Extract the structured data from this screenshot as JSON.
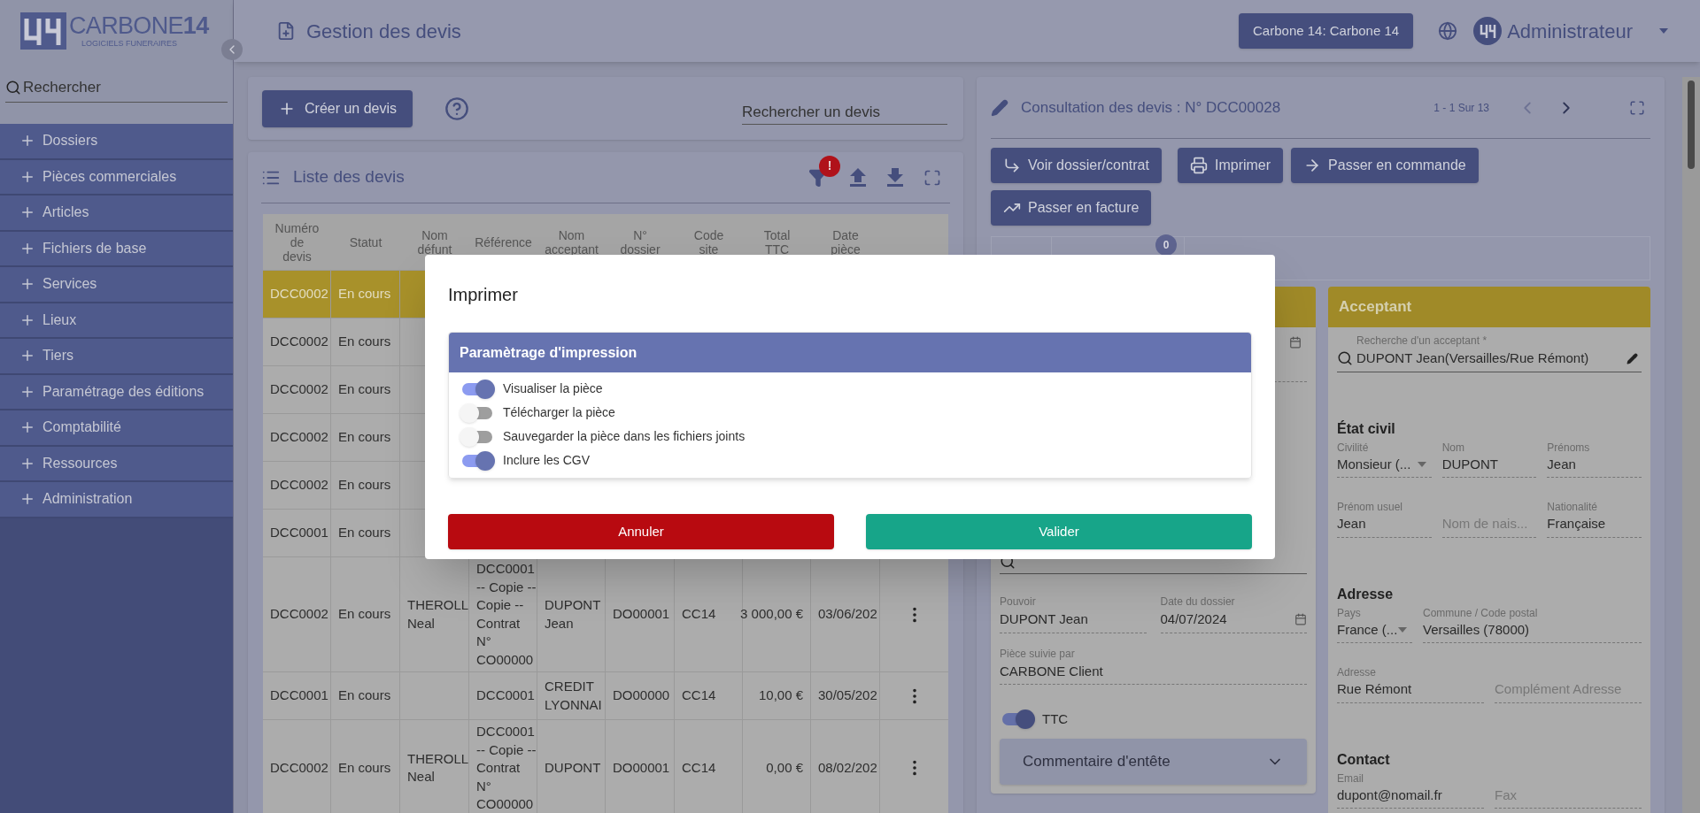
{
  "sidebar": {
    "logo": "CARBONE**14**",
    "tagline": "LOGICIELS FUNERAIRES",
    "search": {
      "placeholder": "Rechercher"
    },
    "items": [
      {
        "label": "Dossiers",
        "expanded": false
      },
      {
        "label": "Pièces commerciales",
        "expanded": false
      },
      {
        "label": "Articles",
        "expanded": false
      },
      {
        "label": "Fichiers de base",
        "expanded": false
      },
      {
        "label": "Services",
        "expanded": false
      },
      {
        "label": "Lieux",
        "expanded": false
      },
      {
        "label": "Tiers",
        "expanded": false
      },
      {
        "label": "Paramétrage des éditions",
        "expanded": false
      },
      {
        "label": "Comptabilité",
        "expanded": false
      },
      {
        "label": "Ressources",
        "expanded": false
      },
      {
        "label": "Administration",
        "expanded": false
      }
    ]
  },
  "header": {
    "title": "Gestion des devis",
    "company_button": "Carbone 14: Carbone 14",
    "user": "Administrateur"
  },
  "quotes_toolbar": {
    "create_button": "Créer un devis",
    "search": {
      "placeholder": "Rechercher un devis"
    }
  },
  "quotes_list": {
    "title": "Liste des devis",
    "filter_badge": "!",
    "columns": [
      "Numéro\nde\ndevis",
      "Statut",
      "Nom\ndéfunt",
      "Référence",
      "Nom\nacceptant",
      "N°\ndossier",
      "Code\nsite",
      "Total\nTTC",
      "Date\npièce"
    ],
    "rows": [
      {
        "selected": true,
        "cells": [
          "DCC0002",
          "En cours"
        ]
      },
      {
        "selected": false,
        "cells": [
          "DCC0002",
          "En cours"
        ]
      },
      {
        "selected": false,
        "cells": [
          "DCC0002",
          "En cours"
        ]
      },
      {
        "selected": false,
        "cells": [
          "DCC0002",
          "En cours"
        ]
      },
      {
        "selected": false,
        "cells": [
          "DCC0002",
          "En cours"
        ]
      },
      {
        "selected": false,
        "cells": [
          "DCC0001",
          "En cours"
        ]
      },
      {
        "selected": false,
        "cells": [
          "DCC0002",
          "En cours",
          "THEROLL\nNeal",
          "DCC0001\n-- Copie --\nCopie --\nContrat\nN°\nCO00000",
          "DUPONT\nJean",
          "DO00001",
          "CC14",
          "3 000,00 €",
          "03/06/202"
        ]
      },
      {
        "selected": false,
        "cells": [
          "DCC0001",
          "En cours",
          "",
          "DCC0001",
          "CREDIT\nLYONNAI",
          "DO00000",
          "CC14",
          "10,00 €",
          "30/05/202"
        ]
      },
      {
        "selected": false,
        "cells": [
          "DCC0002",
          "En cours",
          "THEROLL\nNeal",
          "DCC0001\n-- Copie --\nContrat\nN°\nCO00000",
          "DUPONT",
          "DO00001",
          "CC14",
          "0,00 €",
          "08/02/202"
        ]
      }
    ]
  },
  "consultation": {
    "title": "Consultation des devis : N° DCC00028",
    "pager": "1 - 1 Sur 13",
    "actions": [
      {
        "label": "Voir dossier/contrat",
        "kind": "open"
      },
      {
        "label": "Imprimer",
        "kind": "print"
      },
      {
        "label": "Passer en commande",
        "kind": "order"
      },
      {
        "label": "Passer en facture",
        "kind": "invoice"
      }
    ],
    "attachments_badge": "0",
    "quote_card": {
      "fields": [
        {
          "label": "Pouvoir",
          "value": "DUPONT Jean"
        },
        {
          "label": "Date du dossier",
          "value": "04/07/2024"
        },
        {
          "label": "Pièce suivie par",
          "value": "CARBONE Client"
        }
      ],
      "ttc": {
        "label": "TTC",
        "on": true
      },
      "comment_section": "Commentaire d'entête"
    },
    "acceptant_card": {
      "title": "Acceptant",
      "search": {
        "label": "Recherche d'un acceptant *",
        "value": "DUPONT Jean(Versailles/Rue Rémont)"
      },
      "sections": [
        {
          "title": "État civil",
          "rows": [
            [
              {
                "label": "Civilité",
                "value": "Monsieur (...",
                "kind": "select"
              },
              {
                "label": "Nom",
                "value": "DUPONT",
                "kind": "text"
              },
              {
                "label": "Prénoms",
                "value": "Jean",
                "kind": "text"
              }
            ],
            [
              {
                "label": "Prénom usuel",
                "value": "Jean",
                "kind": "text"
              },
              {
                "placeholder": "Nom de nais...",
                "kind": "text"
              },
              {
                "label": "Nationalité",
                "value": "Française",
                "kind": "text"
              }
            ]
          ]
        },
        {
          "title": "Adresse",
          "rows": [
            [
              {
                "label": "Pays",
                "value": "France (...",
                "kind": "select"
              },
              {
                "label": "Commune / Code postal",
                "value": "Versailles (78000)",
                "kind": "text"
              }
            ],
            [
              {
                "label": "Adresse",
                "value": "Rue Rémont",
                "kind": "text"
              },
              {
                "placeholder": "Complément Adresse",
                "kind": "text"
              }
            ]
          ]
        },
        {
          "title": "Contact",
          "rows": [
            [
              {
                "label": "Email",
                "value": "dupont@nomail.fr",
                "kind": "text"
              },
              {
                "placeholder": "Fax",
                "kind": "text"
              }
            ]
          ]
        }
      ]
    }
  },
  "print_dialog": {
    "title": "Imprimer",
    "section_title": "Paramètrage d'impression",
    "options": [
      {
        "label": "Visualiser la pièce",
        "on": true
      },
      {
        "label": "Télécharger la pièce",
        "on": false
      },
      {
        "label": "Sauvegarder la pièce dans les fichiers joints",
        "on": false
      },
      {
        "label": "Inclure les CGV",
        "on": true
      }
    ],
    "cancel": "Annuler",
    "confirm": "Valider"
  }
}
